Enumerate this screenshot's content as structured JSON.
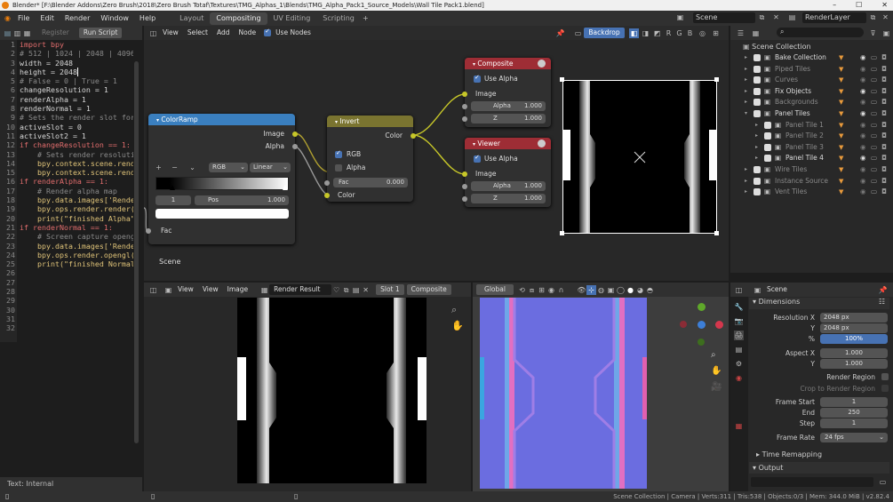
{
  "title": "Blender* [F:\\Blender Addons\\Zero Brush\\2018\\Zero Brush Totaf\\Textures\\TMG_Alphas_1\\Blends\\TMG_Alpha_Pack1_Source_Models\\Wall Tile Pack1.blend]",
  "menu": [
    "File",
    "Edit",
    "Render",
    "Window",
    "Help"
  ],
  "workspaces": [
    "Layout",
    "Compositing",
    "UV Editing",
    "Scripting"
  ],
  "scene_name": "Scene",
  "view_layer": "RenderLayer",
  "text_editor": {
    "register_label": "Register",
    "run_label": "Run Script",
    "lines": [
      "import bpy",
      "# 512 | 1024 | 2048 | 4096",
      "width = 2048",
      "height = 2048",
      "",
      "# False = 0 | True = 1",
      "changeResolution = 1",
      "renderAlpha = 1",
      "renderNormal = 1",
      "",
      "# Sets the render slot for",
      "activeSlot = 0",
      "activeSlot2 = 1",
      "",
      "if changeResolution == 1:",
      "    # Sets render resolution",
      "    bpy.context.scene.rend",
      "    bpy.context.scene.rend",
      "",
      "if renderAlpha == 1:",
      "    # Render alpha map",
      "    bpy.data.images['Render",
      "    bpy.ops.render.render()",
      "    print(\"finished Alpha\")",
      "",
      "if renderNormal == 1:",
      "    # Screen capture opengl",
      "    bpy.data.images['Render",
      "    bpy.ops.render.opengl()",
      "    print(\"finished Normal\"",
      "",
      ""
    ],
    "status": "Text: Internal"
  },
  "node_editor": {
    "menu": [
      "View",
      "Select",
      "Add",
      "Node"
    ],
    "use_nodes": "Use Nodes",
    "backdrop": "Backdrop",
    "tree_label": "Scene",
    "colorramp": {
      "title": "ColorRamp",
      "out_image": "Image",
      "out_alpha": "Alpha",
      "mode": "RGB",
      "interp": "Linear",
      "index": "1",
      "pos_label": "Pos",
      "pos_value": "1.000",
      "in_fac": "Fac"
    },
    "invert": {
      "title": "Invert",
      "out_color": "Color",
      "rgb": "RGB",
      "alpha": "Alpha",
      "fac_label": "Fac",
      "fac_value": "0.000",
      "in_color": "Color"
    },
    "composite": {
      "title": "Composite",
      "use_alpha": "Use Alpha",
      "image": "Image",
      "alpha_label": "Alpha",
      "alpha_value": "1.000",
      "z_label": "Z",
      "z_value": "1.000"
    },
    "viewer": {
      "title": "Viewer",
      "use_alpha": "Use Alpha",
      "image": "Image",
      "alpha_label": "Alpha",
      "alpha_value": "1.000",
      "z_label": "Z",
      "z_value": "1.000"
    }
  },
  "image_editor": {
    "menu": [
      "View",
      "View",
      "Image"
    ],
    "image_name": "Render Result",
    "slot": "Slot 1",
    "layer": "Composite"
  },
  "viewport": {
    "orientation": "Global"
  },
  "outliner": {
    "root": "Scene Collection",
    "items": [
      {
        "label": "Bake Collection",
        "expanded": false,
        "indent": 0,
        "active": true
      },
      {
        "label": "Piped Tiles",
        "expanded": false,
        "indent": 0,
        "active": false
      },
      {
        "label": "Curves",
        "expanded": false,
        "indent": 0,
        "active": false
      },
      {
        "label": "Fix Objects",
        "expanded": false,
        "indent": 0,
        "active": true
      },
      {
        "label": "Backgrounds",
        "expanded": false,
        "indent": 0,
        "active": false
      },
      {
        "label": "Panel Tiles",
        "expanded": true,
        "indent": 0,
        "active": true
      },
      {
        "label": "Panel Tile 1",
        "expanded": false,
        "indent": 1,
        "active": false
      },
      {
        "label": "Panel Tile 2",
        "expanded": false,
        "indent": 1,
        "active": false
      },
      {
        "label": "Panel Tile 3",
        "expanded": false,
        "indent": 1,
        "active": false
      },
      {
        "label": "Panel Tile 4",
        "expanded": false,
        "indent": 1,
        "active": true
      },
      {
        "label": "Wire Tiles",
        "expanded": false,
        "indent": 0,
        "active": false
      },
      {
        "label": "Instance Source",
        "expanded": false,
        "indent": 0,
        "active": false
      },
      {
        "label": "Vent Tiles",
        "expanded": false,
        "indent": 0,
        "active": false
      }
    ]
  },
  "properties": {
    "context": "Scene",
    "dimensions_label": "Dimensions",
    "res_x_label": "Resolution X",
    "res_x": "2048 px",
    "res_y_label": "Y",
    "res_y": "2048 px",
    "res_pct_label": "%",
    "res_pct": "100%",
    "aspect_x_label": "Aspect X",
    "aspect_x": "1.000",
    "aspect_y_label": "Y",
    "aspect_y": "1.000",
    "render_region": "Render Region",
    "crop_region": "Crop to Render Region",
    "frame_start_label": "Frame Start",
    "frame_start": "1",
    "frame_end_label": "End",
    "frame_end": "250",
    "frame_step_label": "Step",
    "frame_step": "1",
    "frame_rate_label": "Frame Rate",
    "frame_rate": "24 fps",
    "time_remap": "Time Remapping",
    "output_label": "Output"
  },
  "statusbar": "Scene Collection | Camera | Verts:311 | Tris:538 | Objects:0/3 | Mem: 344.0 MiB | v2.82.4"
}
